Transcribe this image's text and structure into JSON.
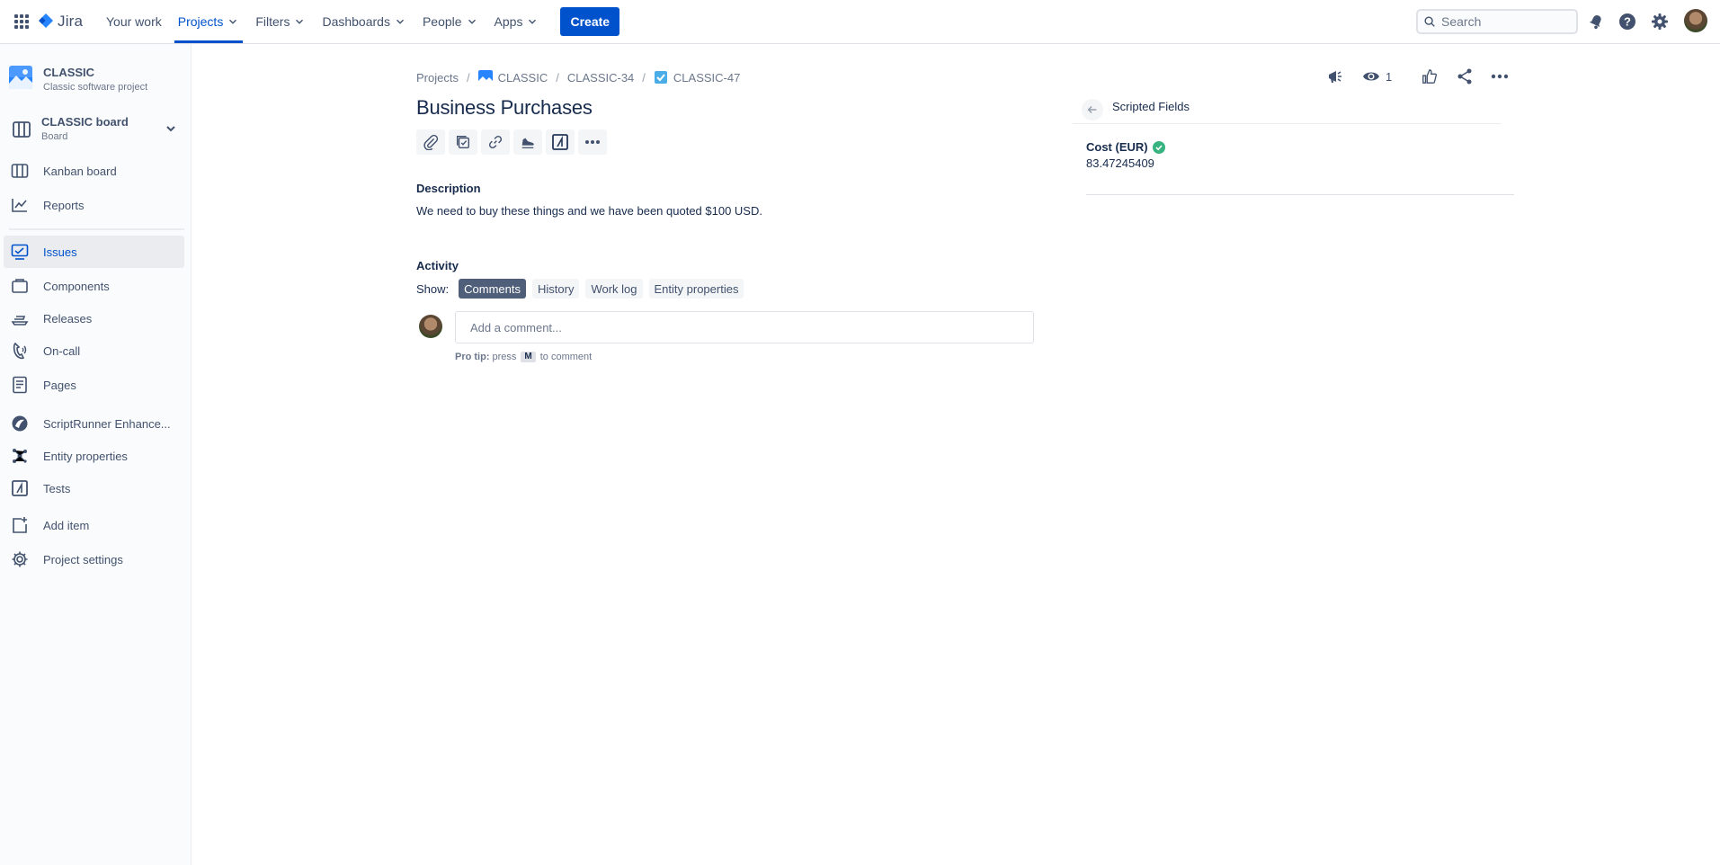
{
  "topnav": {
    "logo_text": "Jira",
    "items": [
      {
        "label": "Your work"
      },
      {
        "label": "Projects"
      },
      {
        "label": "Filters"
      },
      {
        "label": "Dashboards"
      },
      {
        "label": "People"
      },
      {
        "label": "Apps"
      }
    ],
    "create_label": "Create",
    "search_placeholder": "Search",
    "accent_color": "#0052cc"
  },
  "sidebar": {
    "project_name": "CLASSIC",
    "project_type": "Classic software project",
    "board_name": "CLASSIC board",
    "board_type": "Board",
    "items": [
      {
        "label": "Kanban board",
        "icon": "kanban-board-icon"
      },
      {
        "label": "Reports",
        "icon": "reports-icon"
      },
      {
        "label": "Issues",
        "icon": "issues-icon",
        "selected": true
      },
      {
        "label": "Components",
        "icon": "components-icon"
      },
      {
        "label": "Releases",
        "icon": "releases-icon"
      },
      {
        "label": "On-call",
        "icon": "on-call-icon"
      },
      {
        "label": "Pages",
        "icon": "pages-icon"
      },
      {
        "label": "ScriptRunner Enhance...",
        "icon": "scriptrunner-icon"
      },
      {
        "label": "Entity properties",
        "icon": "entity-properties-icon"
      },
      {
        "label": "Tests",
        "icon": "tests-icon"
      },
      {
        "label": "Add item",
        "icon": "add-item-icon"
      },
      {
        "label": "Project settings",
        "icon": "gear-icon"
      }
    ]
  },
  "breadcrumb": {
    "items": [
      "Projects",
      "CLASSIC",
      "CLASSIC-34",
      "CLASSIC-47"
    ]
  },
  "issue": {
    "title": "Business Purchases",
    "description_heading": "Description",
    "description": "We need to buy these things and we have been quoted $100 USD.",
    "activity_heading": "Activity",
    "show_label": "Show:",
    "tabs": [
      "Comments",
      "History",
      "Work log",
      "Entity properties"
    ],
    "comment_placeholder": "Add a comment...",
    "pro_tip_label": "Pro tip:",
    "pro_tip_press": "press",
    "pro_tip_key": "M",
    "pro_tip_rest": "to comment"
  },
  "actions": {
    "watch_count": "1"
  },
  "scripted_fields": {
    "title": "Scripted Fields",
    "field_label": "Cost (EUR)",
    "field_value": "83.47245409"
  }
}
